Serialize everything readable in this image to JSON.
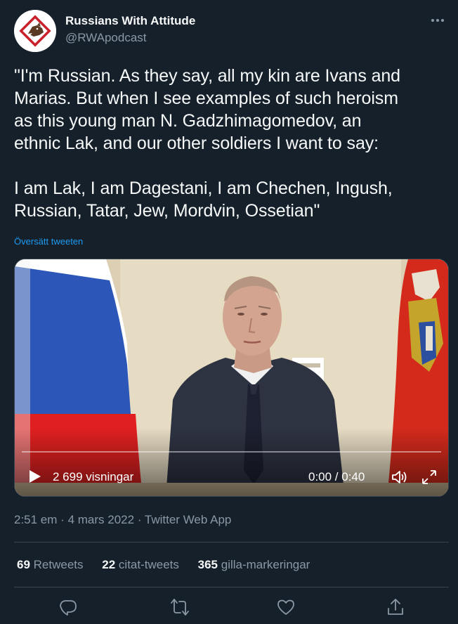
{
  "author": {
    "display_name": "Russians With Attitude",
    "handle": "@RWApodcast"
  },
  "tweet": {
    "lines_paragraph1": [
      "\"I'm Russian. As they say, all my kin are Ivans and",
      "Marias. But when I see examples of such heroism",
      "as this young man N. Gadzhimagomedov, an",
      "ethnic Lak, and our other soldiers I want to say:"
    ],
    "lines_paragraph2": [
      "I am Lak, I am Dagestani, I am Chechen, Ingush,",
      "Russian, Tatar, Jew, Mordvin, Ossetian\""
    ],
    "translate_label": "Översätt tweeten"
  },
  "video": {
    "views": "2 699 visningar",
    "time": "0:00 / 0:40",
    "progress": 0
  },
  "meta": {
    "time": "2:51 em",
    "date": "4 mars 2022",
    "source": "Twitter Web App",
    "separator": "·"
  },
  "stats": {
    "retweets_count": "69",
    "retweets_label": "Retweets",
    "quotes_count": "22",
    "quotes_label": "citat-tweets",
    "likes_count": "365",
    "likes_label": "gilla-markeringar"
  },
  "icons": {
    "more": "more-dots-icon",
    "play": "play-icon",
    "volume": "volume-icon",
    "fullscreen": "fullscreen-icon",
    "reply": "reply-icon",
    "retweet": "retweet-icon",
    "like": "heart-icon",
    "share": "share-icon"
  },
  "colors": {
    "background": "#15202b",
    "text": "#f7f9f9",
    "secondary": "#8b98a5",
    "accent": "#1d9bf0",
    "border": "#38444d"
  }
}
